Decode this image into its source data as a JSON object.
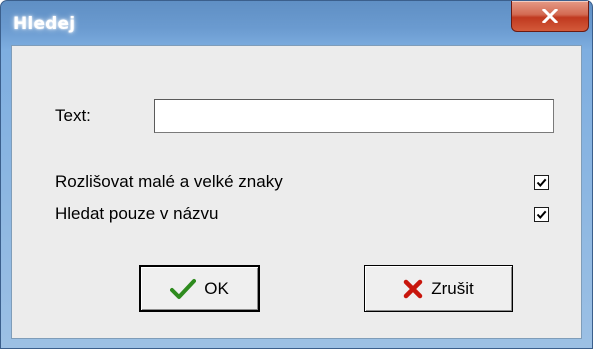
{
  "window": {
    "title": "Hledej",
    "close_icon": "close-icon"
  },
  "form": {
    "text_label": "Text:",
    "text_value": "",
    "options": [
      {
        "label": "Rozlišovat malé a velké znaky",
        "checked": true
      },
      {
        "label": "Hledat pouze v názvu",
        "checked": true
      }
    ]
  },
  "buttons": {
    "ok": {
      "label": "OK",
      "icon": "checkmark-icon",
      "icon_color": "#2e8b1e"
    },
    "cancel": {
      "label": "Zrušit",
      "icon": "x-mark-icon",
      "icon_color": "#c8160c"
    }
  }
}
